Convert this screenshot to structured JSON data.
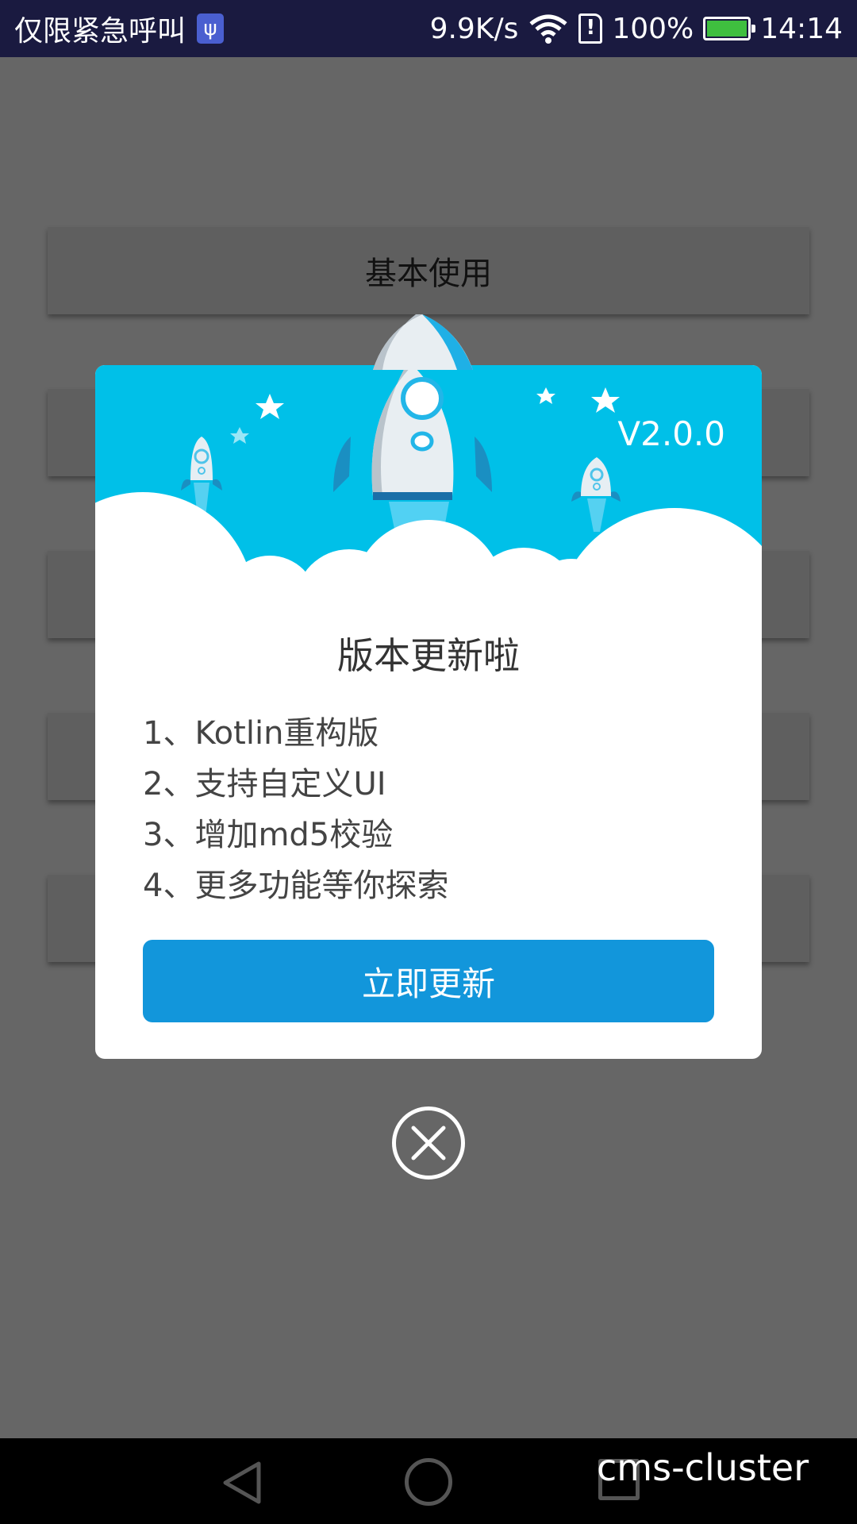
{
  "status_bar": {
    "carrier": "仅限紧急呼叫",
    "speed": "9.9K/s",
    "battery": "100%",
    "time": "14:14",
    "icons": [
      "usb-icon",
      "wifi-icon",
      "sim-card-icon",
      "battery-icon"
    ]
  },
  "background": {
    "buttons": [
      "基本使用",
      "",
      "",
      "",
      ""
    ]
  },
  "dialog": {
    "version": "V2.0.0",
    "title": "版本更新啦",
    "notes": [
      "1、Kotlin重构版",
      "2、支持自定义UI",
      "3、增加md5校验",
      "4、更多功能等你探索"
    ],
    "update_label": "立即更新",
    "header_color": "#00c0e8",
    "button_color": "#1296db"
  },
  "nav_bar": {
    "icons": [
      "back-icon",
      "home-icon",
      "recent-apps-icon"
    ]
  },
  "watermark": "cms-cluster"
}
